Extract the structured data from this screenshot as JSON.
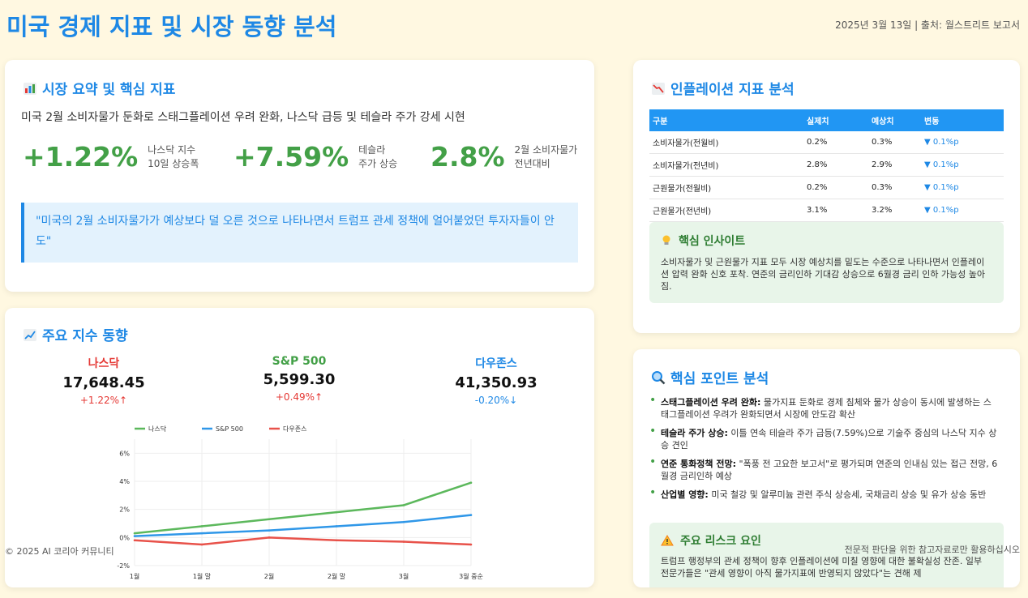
{
  "header": {
    "title": "미국 경제 지표 및 시장 동향 분석",
    "meta": "2025년 3월 13일 | 출처: 월스트리트 보고서"
  },
  "summary": {
    "title": "시장 요약 및 핵심 지표",
    "headline": "미국 2월 소비자물가 둔화로 스태그플레이션 우려 완화, 나스닥 급등 및 테슬라 주가 강세 시현",
    "metrics": [
      {
        "value": "+1.22%",
        "label1": "나스닥 지수",
        "label2": "10일 상승폭"
      },
      {
        "value": "+7.59%",
        "label1": "테슬라",
        "label2": "주가 상승"
      },
      {
        "value": "2.8%",
        "label1": "2월 소비자물가",
        "label2": "전년대비"
      }
    ],
    "quote": "\"미국의 2월 소비자물가가 예상보다 덜 오른 것으로 나타나면서 트럼프 관세 정책에 얼어붙었던 투자자들이 안도\""
  },
  "indices": {
    "title": "주요 지수 동향",
    "items": [
      {
        "name": "나스닥",
        "value": "17,648.45",
        "change": "+1.22%↑",
        "color": "#e53935",
        "change_color": "#e53935"
      },
      {
        "name": "S&P 500",
        "value": "5,599.30",
        "change": "+0.49%↑",
        "color": "#43a047",
        "change_color": "#e53935"
      },
      {
        "name": "다우존스",
        "value": "41,350.93",
        "change": "-0.20%↓",
        "color": "#1e88e5",
        "change_color": "#1e88e5"
      }
    ]
  },
  "chart_data": {
    "type": "line",
    "x": [
      "1월",
      "1월 말",
      "2월",
      "2월 말",
      "3월",
      "3월 중순"
    ],
    "ylim": [
      -2,
      7
    ],
    "yticks": [
      "-2%",
      "0%",
      "2%",
      "4%",
      "6%"
    ],
    "ytick_values": [
      -2,
      0,
      2,
      4,
      6
    ],
    "series": [
      {
        "name": "나스닥",
        "color": "#5cb85c",
        "values": [
          0.3,
          0.8,
          1.3,
          1.8,
          2.3,
          3.9
        ]
      },
      {
        "name": "S&P 500",
        "color": "#2f97e8",
        "values": [
          0.1,
          0.3,
          0.5,
          0.8,
          1.1,
          1.6
        ]
      },
      {
        "name": "다우존스",
        "color": "#e8524a",
        "values": [
          -0.2,
          -0.5,
          0.0,
          -0.2,
          -0.3,
          -0.5
        ]
      }
    ]
  },
  "inflation": {
    "title": "인플레이션 지표 분석",
    "headers": [
      "구분",
      "실제치",
      "예상치",
      "변동"
    ],
    "rows": [
      [
        "소비자물가(전월비)",
        "0.2%",
        "0.3%",
        "▼ 0.1%p"
      ],
      [
        "소비자물가(전년비)",
        "2.8%",
        "2.9%",
        "▼ 0.1%p"
      ],
      [
        "근원물가(전월비)",
        "0.2%",
        "0.3%",
        "▼ 0.1%p"
      ],
      [
        "근원물가(전년비)",
        "3.1%",
        "3.2%",
        "▼ 0.1%p"
      ]
    ],
    "insight_title": "핵심 인사이트",
    "insight_text": "소비자물가 및 근원물가 지표 모두 시장 예상치를 밑도는 수준으로 나타나면서 인플레이션 압력 완화 신호 포착. 연준의 금리인하 기대감 상승으로 6월경 금리 인하 가능성 높아짐."
  },
  "points": {
    "title": "핵심 포인트 분석",
    "items": [
      {
        "bold": "스태그플레이션 우려 완화:",
        "text": " 물가지표 둔화로 경제 침체와 물가 상승이 동시에 발생하는 스태그플레이션 우려가 완화되면서 시장에 안도감 확산"
      },
      {
        "bold": "테슬라 주가 상승:",
        "text": " 이틀 연속 테슬라 주가 급등(7.59%)으로 기술주 중심의 나스닥 지수 상승 견인"
      },
      {
        "bold": "연준 통화정책 전망:",
        "text": " \"폭풍 전 고요한 보고서\"로 평가되며 연준의 인내심 있는 접근 전망, 6월경 금리인하 예상"
      },
      {
        "bold": "산업별 영향:",
        "text": " 미국 철강 및 알루미늄 관련 주식 상승세, 국채금리 상승 및 유가 상승 동반"
      }
    ],
    "risk_title": "주요 리스크 요인",
    "risk_text": "트럼프 행정부의 관세 정책이 향후 인플레이션에 미칠 영향에 대한 불확실성 잔존. 일부 전문가들은 \"관세 영향이 아직 물가지표에 반영되지 않았다\"는 견해 제"
  },
  "footer": {
    "left": "© 2025 AI 코리아 커뮤니티",
    "right": "전문적 판단을 위한 참고자료로만 활용하십시오"
  }
}
